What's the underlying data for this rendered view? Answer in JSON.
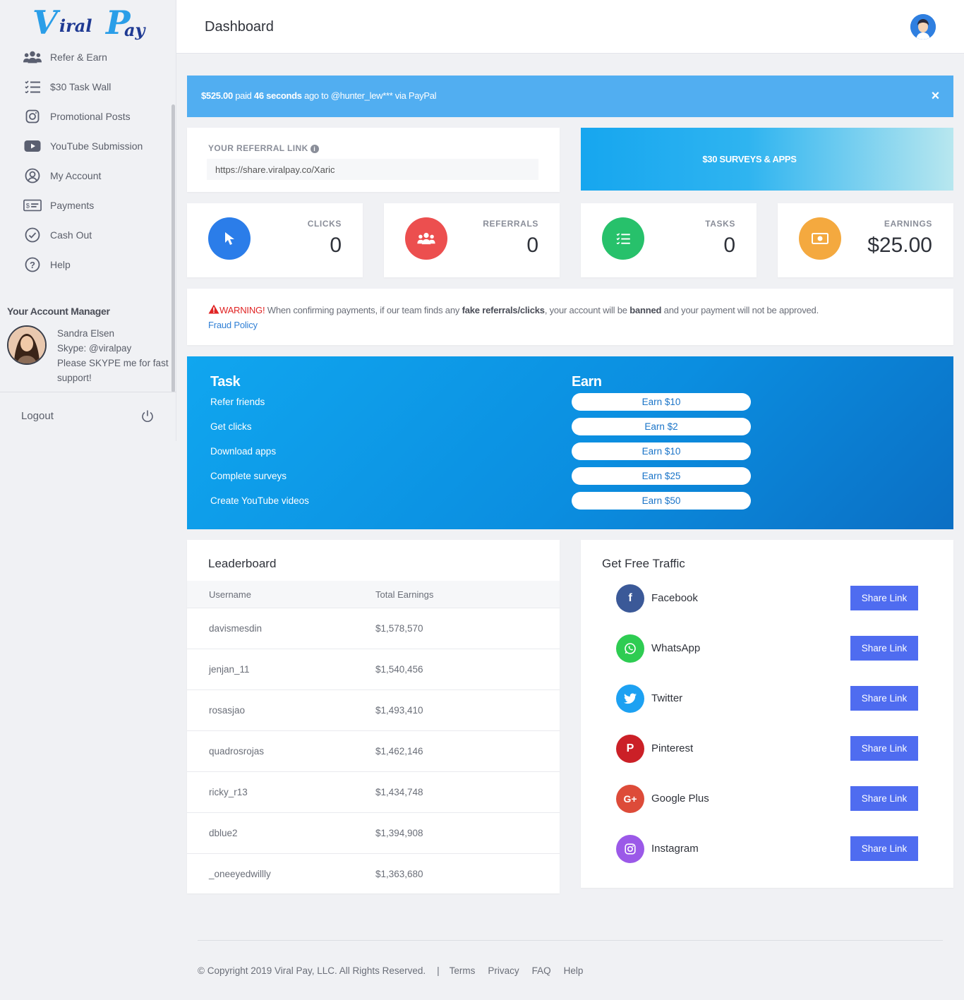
{
  "brand": {
    "logo_v": "V",
    "logo_iral": "iral",
    "logo_p": "P",
    "logo_ay": "ay"
  },
  "sidebar": {
    "items": [
      {
        "label": "Refer & Earn",
        "icon": "users-icon"
      },
      {
        "label": "$30 Task Wall",
        "icon": "list-check-icon"
      },
      {
        "label": "Promotional Posts",
        "icon": "instagram-icon"
      },
      {
        "label": "YouTube Submission",
        "icon": "youtube-icon"
      },
      {
        "label": "My Account",
        "icon": "user-circle-icon"
      },
      {
        "label": "Payments",
        "icon": "money-icon"
      },
      {
        "label": "Cash Out",
        "icon": "check-circle-icon"
      },
      {
        "label": "Help",
        "icon": "question-circle-icon"
      }
    ],
    "manager_title": "Your Account Manager",
    "manager_name": "Sandra Elsen",
    "manager_skype": "Skype: @viralpay",
    "manager_note": "Please SKYPE me for fast support!",
    "logout": "Logout"
  },
  "header": {
    "title": "Dashboard"
  },
  "alert": {
    "amount": "$525.00",
    "paid": " paid ",
    "time": "46 seconds",
    "rest": " ago to @hunter_lew*** via PayPal",
    "close": "×"
  },
  "referral": {
    "label": "YOUR REFERRAL LINK",
    "link": "https://share.viralpay.co/Xaric"
  },
  "surveys": {
    "label": "$30 SURVEYS & APPS"
  },
  "stats": [
    {
      "label": "CLICKS",
      "value": "0",
      "color": "#2b7de9",
      "icon": "cursor-icon"
    },
    {
      "label": "REFERRALS",
      "value": "0",
      "color": "#ec4f4f",
      "icon": "users-icon"
    },
    {
      "label": "TASKS",
      "value": "0",
      "color": "#27c16b",
      "icon": "list-check-icon"
    },
    {
      "label": "EARNINGS",
      "value": "$25.00",
      "color": "#f4a93f",
      "icon": "money-icon"
    }
  ],
  "warning": {
    "title": "WARNING!",
    "text1": " When confirming payments, if our team finds any ",
    "bold1": "fake referrals/clicks",
    "text2": ", your account will be ",
    "bold2": "banned",
    "text3": " and your payment will not be approved.",
    "link": "Fraud Policy"
  },
  "task_panel": {
    "task_title": "Task",
    "earn_title": "Earn",
    "rows": [
      {
        "task": "Refer friends",
        "earn": "Earn $10"
      },
      {
        "task": "Get clicks",
        "earn": "Earn $2"
      },
      {
        "task": "Download apps",
        "earn": "Earn $10"
      },
      {
        "task": "Complete surveys",
        "earn": "Earn $25"
      },
      {
        "task": "Create YouTube videos",
        "earn": "Earn $50"
      }
    ]
  },
  "leaderboard": {
    "title": "Leaderboard",
    "columns": [
      "Username",
      "Total Earnings"
    ],
    "rows": [
      [
        "davismesdin",
        "$1,578,570"
      ],
      [
        "jenjan_11",
        "$1,540,456"
      ],
      [
        "rosasjao",
        "$1,493,410"
      ],
      [
        "quadrosrojas",
        "$1,462,146"
      ],
      [
        "ricky_r13",
        "$1,434,748"
      ],
      [
        "dblue2",
        "$1,394,908"
      ],
      [
        "_oneeyedwillly",
        "$1,363,680"
      ]
    ]
  },
  "traffic": {
    "title": "Get Free Traffic",
    "button": "Share Link",
    "items": [
      {
        "name": "Facebook",
        "glyph": "f",
        "color": "#3b5998",
        "icon": "facebook-icon"
      },
      {
        "name": "WhatsApp",
        "glyph": "✆",
        "color": "#2ecc52",
        "icon": "whatsapp-icon"
      },
      {
        "name": "Twitter",
        "glyph": "🐦",
        "color": "#1da1f2",
        "icon": "twitter-icon"
      },
      {
        "name": "Pinterest",
        "glyph": "P",
        "color": "#cb2027",
        "icon": "pinterest-icon"
      },
      {
        "name": "Google Plus",
        "glyph": "G+",
        "color": "#dd4b39",
        "icon": "google-plus-icon"
      },
      {
        "name": "Instagram",
        "glyph": "◎",
        "color": "#9b59e8",
        "icon": "instagram-icon"
      }
    ]
  },
  "footer": {
    "copyright": "© Copyright 2019 Viral Pay, LLC. All Rights Reserved.",
    "sep": "|",
    "links": [
      "Terms",
      "Privacy",
      "FAQ",
      "Help"
    ]
  }
}
